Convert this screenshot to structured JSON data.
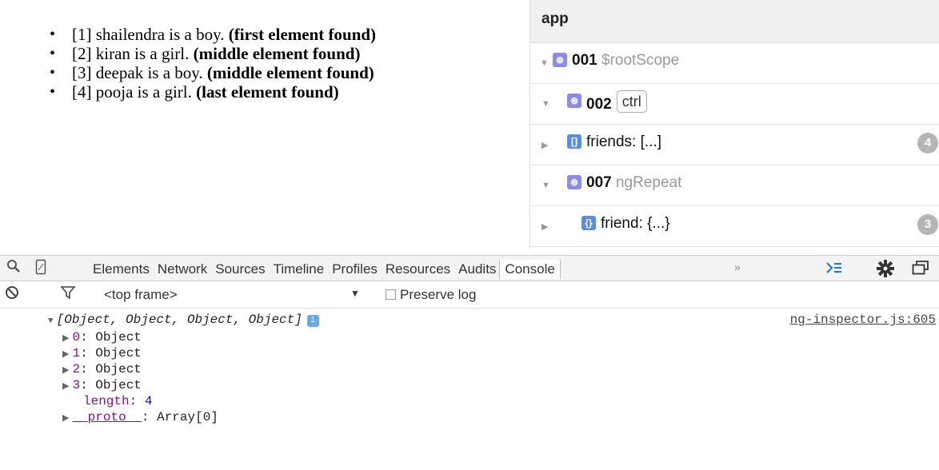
{
  "page_list": {
    "items": [
      {
        "text": "[1] shailendra is a boy. ",
        "bold": "(first element found)"
      },
      {
        "text": "[2] kiran is a girl. ",
        "bold": "(middle element found)"
      },
      {
        "text": "[3] deepak is a boy. ",
        "bold": "(middle element found)"
      },
      {
        "text": "[4] pooja is a girl. ",
        "bold": "(last element found)"
      }
    ]
  },
  "inspector": {
    "title": "app",
    "rows": [
      {
        "id": "001",
        "label": "$rootScope"
      },
      {
        "id": "002",
        "tag": "ctrl"
      },
      {
        "label": "friends: [...]",
        "count": "4"
      },
      {
        "id": "007",
        "label": "ngRepeat"
      },
      {
        "label": "friend: {...}",
        "count": "3"
      }
    ]
  },
  "toolbar": {
    "tabs": [
      "Elements",
      "Network",
      "Sources",
      "Timeline",
      "Profiles",
      "Resources",
      "Audits",
      "Console"
    ],
    "active_tab": "Console",
    "more": "»"
  },
  "console_bar": {
    "frame": "<top frame>",
    "preserve_log": "Preserve log"
  },
  "console": {
    "head": "[Object, Object, Object, Object]",
    "source": "ng-inspector.js:605",
    "items": [
      {
        "key": "0",
        "value": "Object"
      },
      {
        "key": "1",
        "value": "Object"
      },
      {
        "key": "2",
        "value": "Object"
      },
      {
        "key": "3",
        "value": "Object"
      }
    ],
    "length_key": "length",
    "length_value": "4",
    "proto_key": "__proto__",
    "proto_value": "Array[0]"
  }
}
